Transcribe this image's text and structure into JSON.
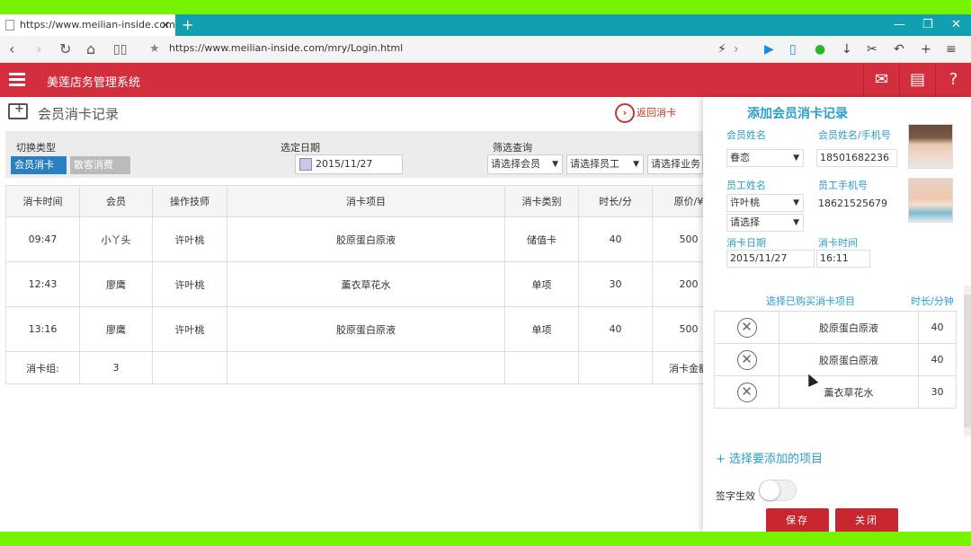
{
  "browser": {
    "tab_title": "https://www.meilian-inside.com/m",
    "tab_close": "✕",
    "new_tab": "+",
    "url": "https://www.meilian-inside.com/mry/Login.html",
    "window_controls": [
      "—",
      "❐",
      "✕"
    ]
  },
  "app": {
    "title": "美莲店务管理系统"
  },
  "page": {
    "title": "会员消卡记录",
    "back_label": "返回消卡",
    "filters": {
      "type_label": "切换类型",
      "type_member": "会员消卡",
      "type_guest": "散客消费",
      "date_label": "选定日期",
      "date_value": "2015/11/27",
      "search_label": "筛选查询",
      "select_member": "请选择会员",
      "select_staff": "请选择员工",
      "select_business": "请选择业务"
    },
    "table": {
      "headers": [
        "消卡时间",
        "会员",
        "操作技师",
        "消卡项目",
        "消卡类别",
        "时长/分",
        "原价/¥"
      ],
      "rows": [
        [
          "09:47",
          "小丫头",
          "许叶桃",
          "胶原蛋白原液",
          "储值卡",
          "40",
          "500"
        ],
        [
          "12:43",
          "廖鹰",
          "许叶桃",
          "薰衣草花水",
          "单项",
          "30",
          "200"
        ],
        [
          "13:16",
          "廖鹰",
          "许叶桃",
          "胶原蛋白原液",
          "单项",
          "40",
          "500"
        ]
      ],
      "footer": {
        "count_label": "消卡组:",
        "count_value": "3",
        "amount_label": "消卡金额"
      }
    }
  },
  "panel": {
    "title": "添加会员消卡记录",
    "member_name_label": "会员姓名",
    "member_name_value": "眷恋",
    "member_search_label": "会员姓名/手机号",
    "member_phone": "18501682236",
    "staff_name_label": "员工姓名",
    "staff_name_value": "许叶桃",
    "staff_second_select": "请选择",
    "staff_phone_label": "员工手机号",
    "staff_phone": "18621525679",
    "card_date_label": "消卡日期",
    "card_date_value": "2015/11/27",
    "card_time_label": "消卡时间",
    "card_time_value": "16:11",
    "items_header": "选择已购买消卡项目",
    "items_duration_header": "时长/分钟",
    "items": [
      {
        "name": "胶原蛋白原液",
        "duration": "40"
      },
      {
        "name": "胶原蛋白原液",
        "duration": "40"
      },
      {
        "name": "薰衣草花水",
        "duration": "30"
      }
    ],
    "add_project": "+ 选择要添加的项目",
    "sign_label": "签字生效",
    "sign_enabled": false,
    "save_button": "保存",
    "close_button": "关闭"
  },
  "colors": {
    "header_red": "#d32e3e",
    "accent_blue": "#2a9ec8",
    "button_red": "#c8272f",
    "tab_teal": "#129fb0",
    "outer_green": "#76f200"
  }
}
